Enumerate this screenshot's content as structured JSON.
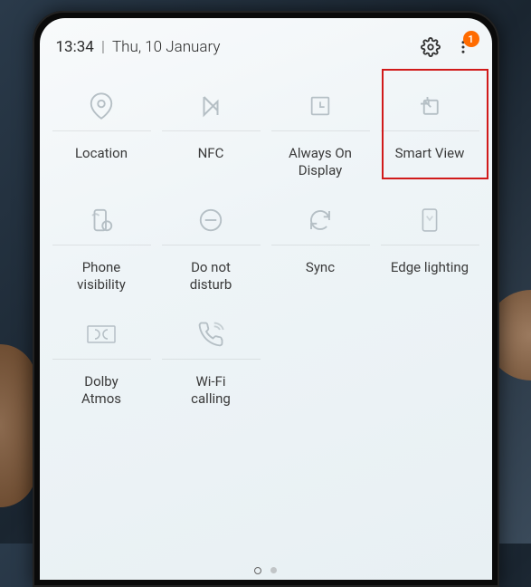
{
  "status": {
    "time": "13:34",
    "date": "Thu, 10 January",
    "badge_count": "1"
  },
  "tiles": [
    {
      "label": "Location"
    },
    {
      "label": "NFC"
    },
    {
      "label": "Always On\nDisplay"
    },
    {
      "label": "Smart View"
    },
    {
      "label": "Phone\nvisibility"
    },
    {
      "label": "Do not\ndisturb"
    },
    {
      "label": "Sync"
    },
    {
      "label": "Edge lighting"
    },
    {
      "label": "Dolby\nAtmos"
    },
    {
      "label": "Wi-Fi\ncalling"
    }
  ],
  "pager": {
    "current": 0,
    "total": 2
  },
  "highlighted_tile": "Smart View"
}
